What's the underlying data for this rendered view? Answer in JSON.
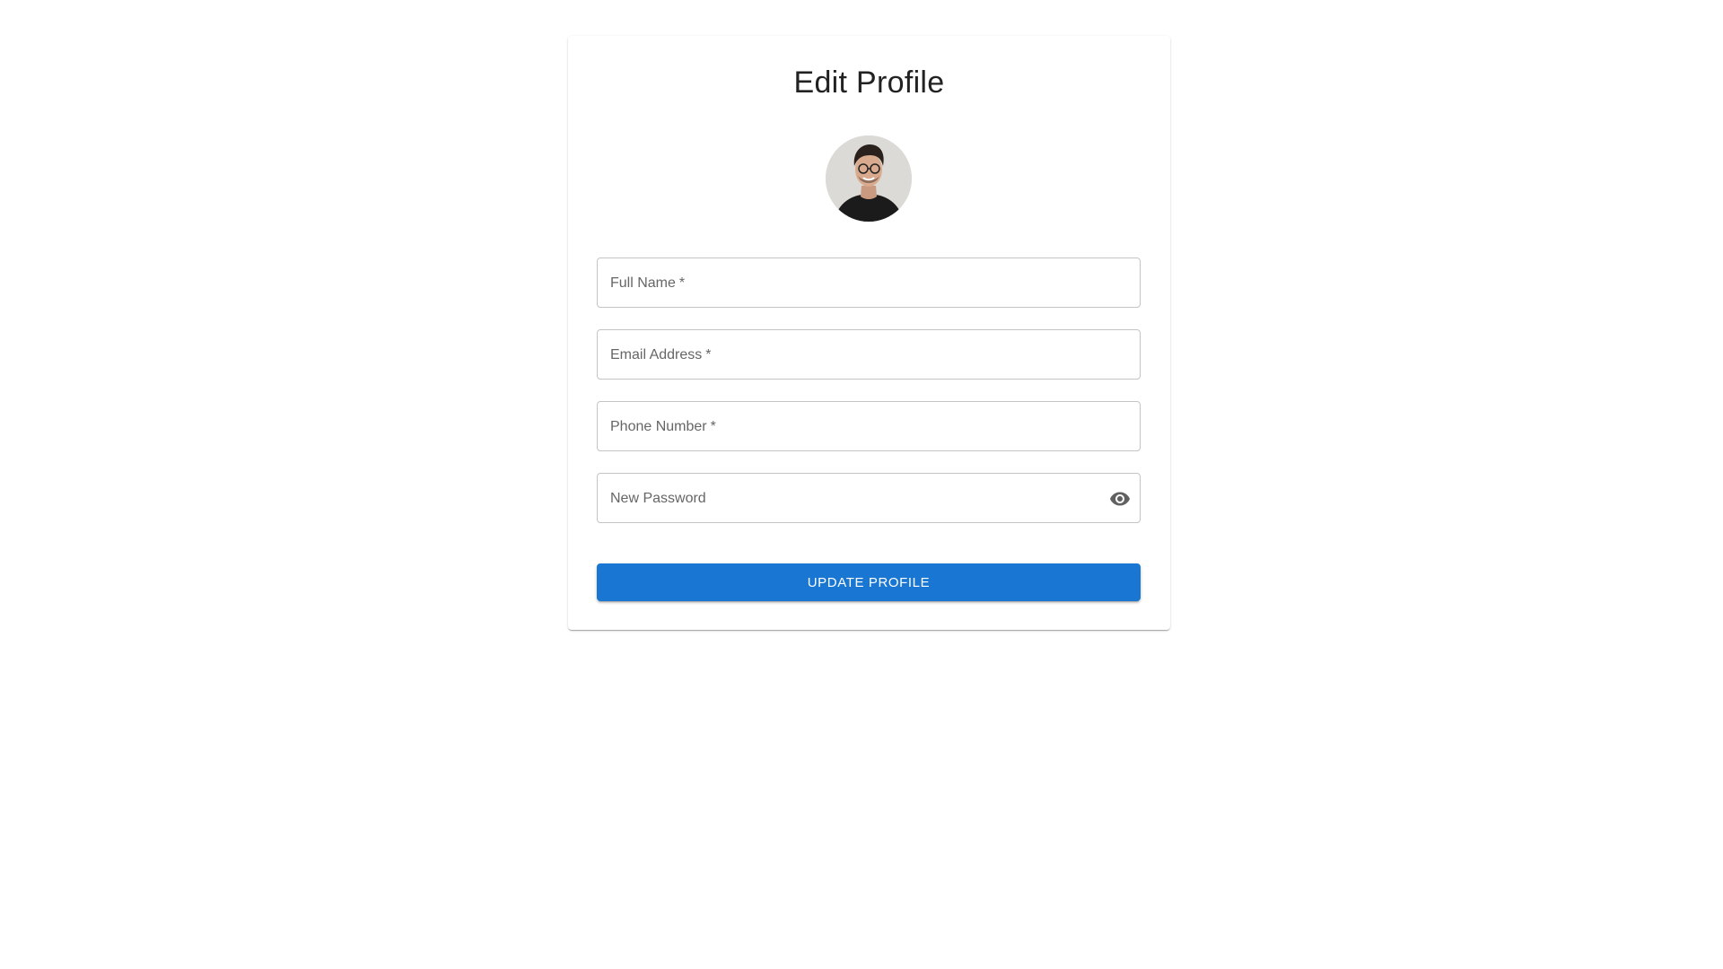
{
  "page": {
    "title": "Edit Profile"
  },
  "avatar": {
    "icon": "user-avatar-photo"
  },
  "fields": {
    "full_name": {
      "label": "Full Name",
      "required_mark": "*",
      "value": ""
    },
    "email": {
      "label": "Email Address",
      "required_mark": "*",
      "value": ""
    },
    "phone": {
      "label": "Phone Number",
      "required_mark": "*",
      "value": ""
    },
    "password": {
      "label": "New Password",
      "value": "",
      "toggle_icon": "eye-icon"
    }
  },
  "actions": {
    "submit_label": "Update Profile"
  },
  "colors": {
    "primary": "#1976d2",
    "border": "#c4c4c4",
    "label": "#666666",
    "title": "#222222"
  }
}
